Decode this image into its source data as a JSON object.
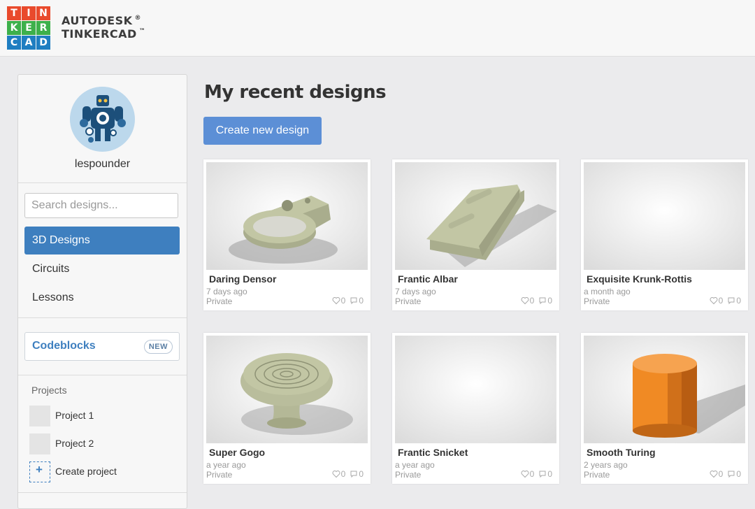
{
  "brand": {
    "logo_letters": [
      "T",
      "I",
      "N",
      "K",
      "E",
      "R",
      "C",
      "A",
      "D"
    ],
    "logo_colors": [
      "#e94a2c",
      "#e94a2c",
      "#e94a2c",
      "#3db04b",
      "#3db04b",
      "#3db04b",
      "#1f7ec1",
      "#1f7ec1",
      "#1f7ec1"
    ],
    "line1": "AUTODESK",
    "line1_mark": "®",
    "line2": "TINKERCAD",
    "line2_mark": "™"
  },
  "sidebar": {
    "username": "lespounder",
    "search_placeholder": "Search designs...",
    "nav": [
      {
        "label": "3D Designs",
        "active": true
      },
      {
        "label": "Circuits",
        "active": false
      },
      {
        "label": "Lessons",
        "active": false
      }
    ],
    "codeblocks": {
      "label": "Codeblocks",
      "badge": "NEW"
    },
    "projects_heading": "Projects",
    "projects": [
      "Project 1",
      "Project 2"
    ],
    "create_project": "Create project",
    "create_project_icon": "+"
  },
  "main": {
    "title": "My recent designs",
    "create_button": "Create new design",
    "designs": [
      {
        "title": "Daring Densor",
        "time": "7 days ago",
        "visibility": "Private",
        "likes": "0",
        "comments": "0",
        "thumb": "bracket"
      },
      {
        "title": "Frantic Albar",
        "time": "7 days ago",
        "visibility": "Private",
        "likes": "0",
        "comments": "0",
        "thumb": "slide"
      },
      {
        "title": "Exquisite Krunk-Rottis",
        "time": "a month ago",
        "visibility": "Private",
        "likes": "0",
        "comments": "0",
        "thumb": "blank"
      },
      {
        "title": "Super Gogo",
        "time": "a year ago",
        "visibility": "Private",
        "likes": "0",
        "comments": "0",
        "thumb": "knob"
      },
      {
        "title": "Frantic Snicket",
        "time": "a year ago",
        "visibility": "Private",
        "likes": "0",
        "comments": "0",
        "thumb": "blank"
      },
      {
        "title": "Smooth Turing",
        "time": "2 years ago",
        "visibility": "Private",
        "likes": "0",
        "comments": "0",
        "thumb": "cylinder"
      }
    ]
  },
  "colors": {
    "accent": "#3e7fbf",
    "button": "#5c8fd6",
    "model_green": "#c2c6a4",
    "model_orange": "#f08a24"
  }
}
